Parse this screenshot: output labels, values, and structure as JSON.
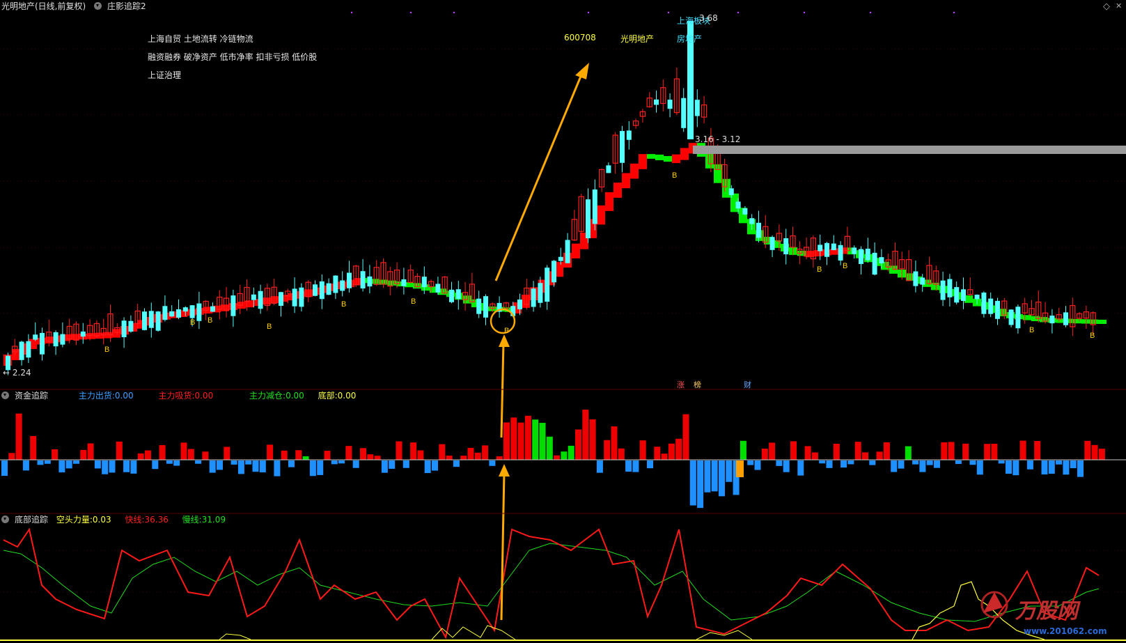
{
  "header": {
    "stock_title": "光明地产(日线,前复权)",
    "indicator_name": "庄影追踪2"
  },
  "concept_tags": [
    "上海自贸 土地流转 冷链物流",
    "融资融券 破净资产 低市净率 扣非亏损 低价股",
    "上证治理"
  ],
  "stock_code": "600708",
  "stock_name": "光明地产",
  "sector_top": "上海板块",
  "sector_bottom": "房地产",
  "price_high_label": "3.68",
  "price_low_label": "2.24",
  "resistance_label": "3.16 - 3.12",
  "buy_marker": "B",
  "event_marks": [
    "涨",
    "榜",
    "财"
  ],
  "fund_panel": {
    "title": "资金追踪",
    "items": [
      {
        "label": "主力出货:",
        "value": "0.00",
        "color": "#3ea0ff"
      },
      {
        "label": "主力吸货:",
        "value": "0.00",
        "color": "#ff2020"
      },
      {
        "label": "主力减仓:",
        "value": "0.00",
        "color": "#20e020"
      },
      {
        "label": "底部:",
        "value": "0.00",
        "color": "#ffff40"
      }
    ]
  },
  "bottom_panel": {
    "title": "底部追踪",
    "items": [
      {
        "label": "空头力量:",
        "value": "0.03",
        "color": "#ffff40"
      },
      {
        "label": "快线:",
        "value": "36.36",
        "color": "#ff2020"
      },
      {
        "label": "慢线:",
        "value": "31.09",
        "color": "#20e020"
      }
    ]
  },
  "watermark": {
    "brand": "万股网",
    "url": "www.201062.com"
  },
  "colors": {
    "up": "#ff2020",
    "down": "#54ffff",
    "trend_up": "#ff0000",
    "trend_down": "#00ee00",
    "arrow": "#ffaa00",
    "fund_out": "#1e90ff",
    "fund_in": "#ee0000",
    "fund_reduce": "#00dd00"
  }
}
